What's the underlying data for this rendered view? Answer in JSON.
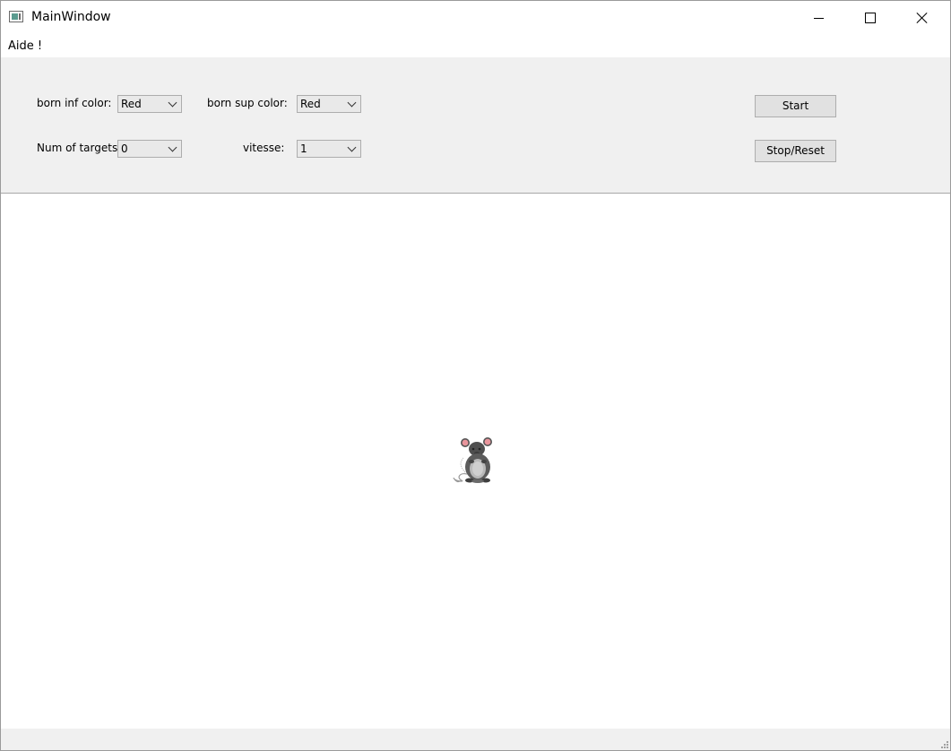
{
  "window": {
    "title": "MainWindow",
    "icon": "app-window-icon"
  },
  "menu": {
    "items": [
      "Aide !"
    ]
  },
  "controls": {
    "born_inf": {
      "label": "born inf color:",
      "value": "Red"
    },
    "born_sup": {
      "label": "born sup color:",
      "value": "Red"
    },
    "num_targets": {
      "label": "Num of targets:",
      "value": "0"
    },
    "vitesse": {
      "label": "vitesse:",
      "value": "1"
    }
  },
  "buttons": {
    "start": "Start",
    "stop_reset": "Stop/Reset"
  },
  "canvas": {
    "sprite": "mouse-icon"
  }
}
